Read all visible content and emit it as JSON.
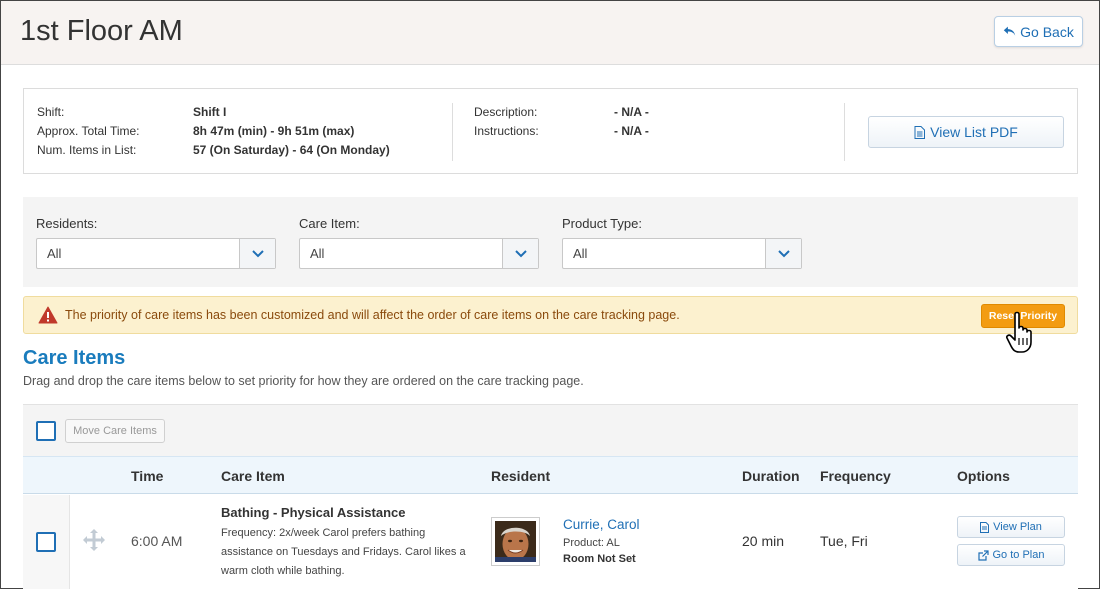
{
  "header": {
    "title": "1st Floor AM",
    "go_back_label": "Go Back"
  },
  "info": {
    "shift_label": "Shift:",
    "shift_value": "Shift I",
    "time_label": "Approx. Total Time:",
    "time_value": "8h 47m (min) - 9h 51m (max)",
    "items_label": "Num. Items in List:",
    "items_value": "57 (On Saturday) - 64 (On Monday)",
    "description_label": "Description:",
    "description_value": "- N/A -",
    "instructions_label": "Instructions:",
    "instructions_value": "- N/A -",
    "pdf_button_label": "View List PDF"
  },
  "filters": {
    "residents_label": "Residents:",
    "residents_value": "All",
    "care_item_label": "Care Item:",
    "care_item_value": "All",
    "product_type_label": "Product Type:",
    "product_type_value": "All"
  },
  "alert": {
    "text": "The priority of care items has been customized and will affect the order of care items on the care tracking page.",
    "reset_button_label": "Reset Priority",
    "color": "#f39c12"
  },
  "care_items": {
    "title": "Care Items",
    "subtitle": "Drag and drop the care items below to set priority for how they are ordered on the care tracking page.",
    "move_button_label": "Move Care Items",
    "columns": [
      "Time",
      "Care Item",
      "Resident",
      "Duration",
      "Frequency",
      "Options"
    ],
    "rows": [
      {
        "time": "6:00 AM",
        "care_item": "Bathing - Physical Assistance",
        "description": "Frequency: 2x/week Carol prefers bathing assistance on Tuesdays and Fridays. Carol likes a warm cloth while bathing.",
        "resident_name": "Currie, Carol",
        "product": "Product: AL",
        "room": "Room Not Set",
        "duration": "20 min",
        "frequency": "Tue, Fri",
        "view_plan_label": "View Plan",
        "go_to_plan_label": "Go to Plan"
      }
    ]
  },
  "accent_color": "#1f6fb5"
}
